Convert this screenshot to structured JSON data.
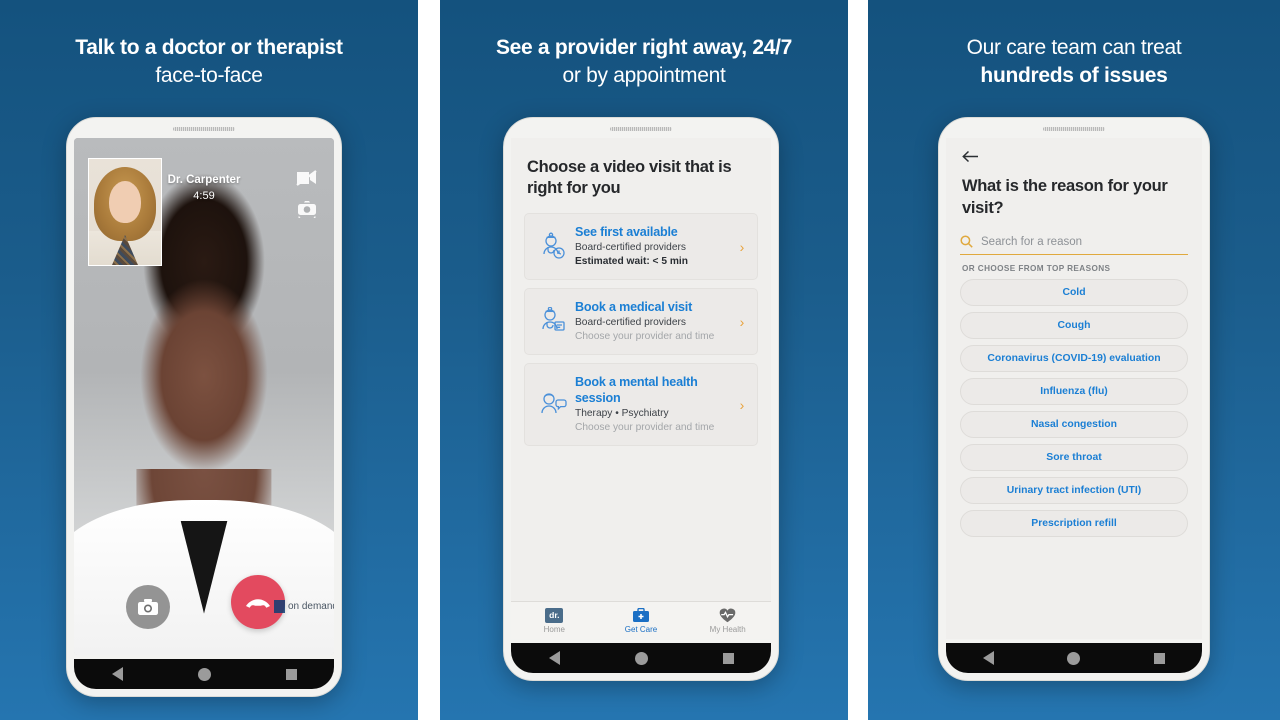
{
  "theme": {
    "bg_blue_top": "#14527e",
    "bg_blue_bottom": "#2575b0",
    "link_blue": "#1b7fd4",
    "accent_gold": "#e0a93e",
    "end_call_red": "#e34a5f"
  },
  "panels": [
    {
      "headline_line1": "Talk to a doctor or therapist",
      "headline_line2": "face-to-face",
      "phone": {
        "call": {
          "provider_name": "Dr. Carpenter",
          "timer": "4:59",
          "video_icon": "video-off-icon",
          "flip_icon": "camera-flip-icon",
          "camera_button_icon": "camera-icon",
          "end_call_icon": "end-call-icon",
          "watermark": "on demand"
        }
      }
    },
    {
      "headline_line1": "See a provider right away, 24/7",
      "headline_line2": "or by appointment",
      "phone": {
        "title": "Choose a video visit that is right for you",
        "options": [
          {
            "icon": "doctor-clock-icon",
            "title": "See first available",
            "sub1": "Board-certified providers",
            "sub2": "Estimated wait: < 5 min",
            "sub3": "",
            "chevron": "›"
          },
          {
            "icon": "doctor-badge-icon",
            "title": "Book a medical visit",
            "sub1": "Board-certified providers",
            "sub2": "",
            "sub3": "Choose your provider and time",
            "chevron": "›"
          },
          {
            "icon": "therapist-speech-icon",
            "title": "Book a mental health session",
            "sub1": "Therapy • Psychiatry",
            "sub2": "",
            "sub3": "Choose your provider and time",
            "chevron": "›"
          }
        ],
        "tabs": [
          {
            "icon": "dr-logo-icon",
            "icon_text": "dr.",
            "label": "Home",
            "active": false
          },
          {
            "icon": "medical-bag-icon",
            "label": "Get Care",
            "active": true
          },
          {
            "icon": "heart-pulse-icon",
            "label": "My Health",
            "active": false
          }
        ]
      }
    },
    {
      "headline_line1": "Our care team can treat",
      "headline_line2": "hundreds of issues",
      "phone": {
        "back_icon": "back-arrow-icon",
        "title": "What is the reason for your visit?",
        "search_icon": "search-icon",
        "search_placeholder": "Search for a reason",
        "or_label": "OR CHOOSE FROM TOP REASONS",
        "reasons": [
          "Cold",
          "Cough",
          "Coronavirus (COVID-19) evaluation",
          "Influenza (flu)",
          "Nasal congestion",
          "Sore throat",
          "Urinary tract infection (UTI)",
          "Prescription refill"
        ]
      }
    }
  ],
  "android_nav": {
    "back": "back-triangle-icon",
    "home": "home-circle-icon",
    "recents": "recents-square-icon"
  }
}
